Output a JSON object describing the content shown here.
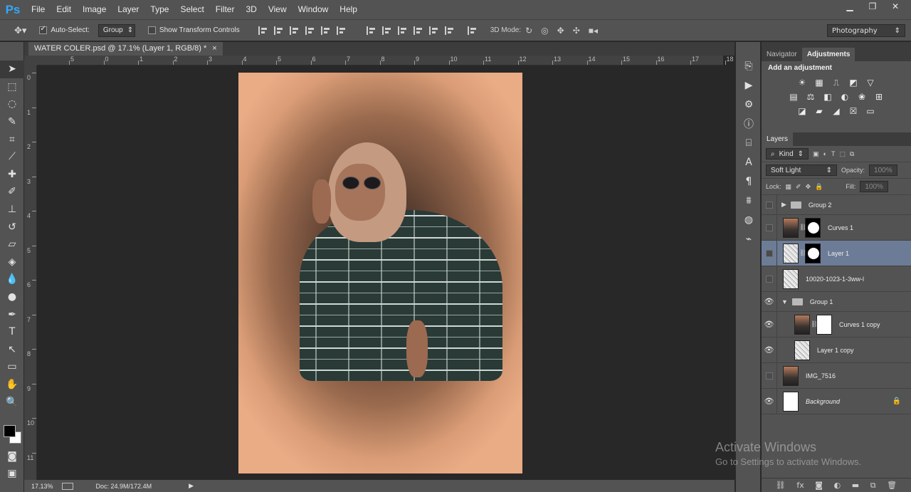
{
  "app": {
    "logo": "Ps"
  },
  "menu": [
    "File",
    "Edit",
    "Image",
    "Layer",
    "Type",
    "Select",
    "Filter",
    "3D",
    "View",
    "Window",
    "Help"
  ],
  "window_controls": {
    "minimize": "▁",
    "restore": "❐",
    "close": "✕"
  },
  "options": {
    "auto_select_label": "Auto-Select:",
    "auto_select_value": "Group",
    "transform_label": "Show Transform Controls",
    "mode3d_label": "3D Mode:",
    "workspace": "Photography"
  },
  "document": {
    "tab_title": "WATER COLER.psd @ 17.1% (Layer 1, RGB/8) *",
    "tab_close": "×"
  },
  "rulers": {
    "top": [
      "5",
      "0",
      "1",
      "2",
      "3",
      "4",
      "5",
      "6",
      "7",
      "8",
      "9",
      "10",
      "11",
      "12",
      "13",
      "14",
      "15",
      "16",
      "17",
      "18"
    ],
    "left": [
      "0",
      "1",
      "2",
      "3",
      "4",
      "5",
      "6",
      "7",
      "8",
      "9",
      "10",
      "11"
    ]
  },
  "status": {
    "zoom": "17.13%",
    "doc": "Doc: 24.9M/172.4M",
    "arrow": "▶"
  },
  "panels": {
    "top_tabs": [
      "Navigator",
      "Adjustments"
    ],
    "adjustments_title": "Add an adjustment",
    "layers_tab": "Layers",
    "kind_label": "Kind",
    "blend_mode": "Soft Light",
    "opacity_label": "Opacity:",
    "opacity_value": "100%",
    "lock_label": "Lock:",
    "fill_label": "Fill:",
    "fill_value": "100%"
  },
  "layers": [
    {
      "name": "Group 2",
      "type": "group",
      "expanded": false,
      "visible": false
    },
    {
      "name": "Curves 1",
      "type": "adjustment",
      "visible": false
    },
    {
      "name": "Layer 1",
      "type": "masked",
      "visible": false,
      "selected": true
    },
    {
      "name": "10020-1023-1-3ww-l",
      "type": "smart",
      "visible": false
    },
    {
      "name": "Group 1",
      "type": "group",
      "expanded": true,
      "visible": true
    },
    {
      "name": "Curves 1 copy",
      "type": "adjustment-white",
      "visible": true,
      "indent": true
    },
    {
      "name": "Layer 1 copy",
      "type": "plain",
      "visible": true,
      "indent": true
    },
    {
      "name": "IMG_7516",
      "type": "photo",
      "visible": false
    },
    {
      "name": "Background",
      "type": "background",
      "visible": true,
      "locked": true
    }
  ],
  "watermark": {
    "line1": "Activate Windows",
    "line2": "Go to Settings to activate Windows."
  }
}
